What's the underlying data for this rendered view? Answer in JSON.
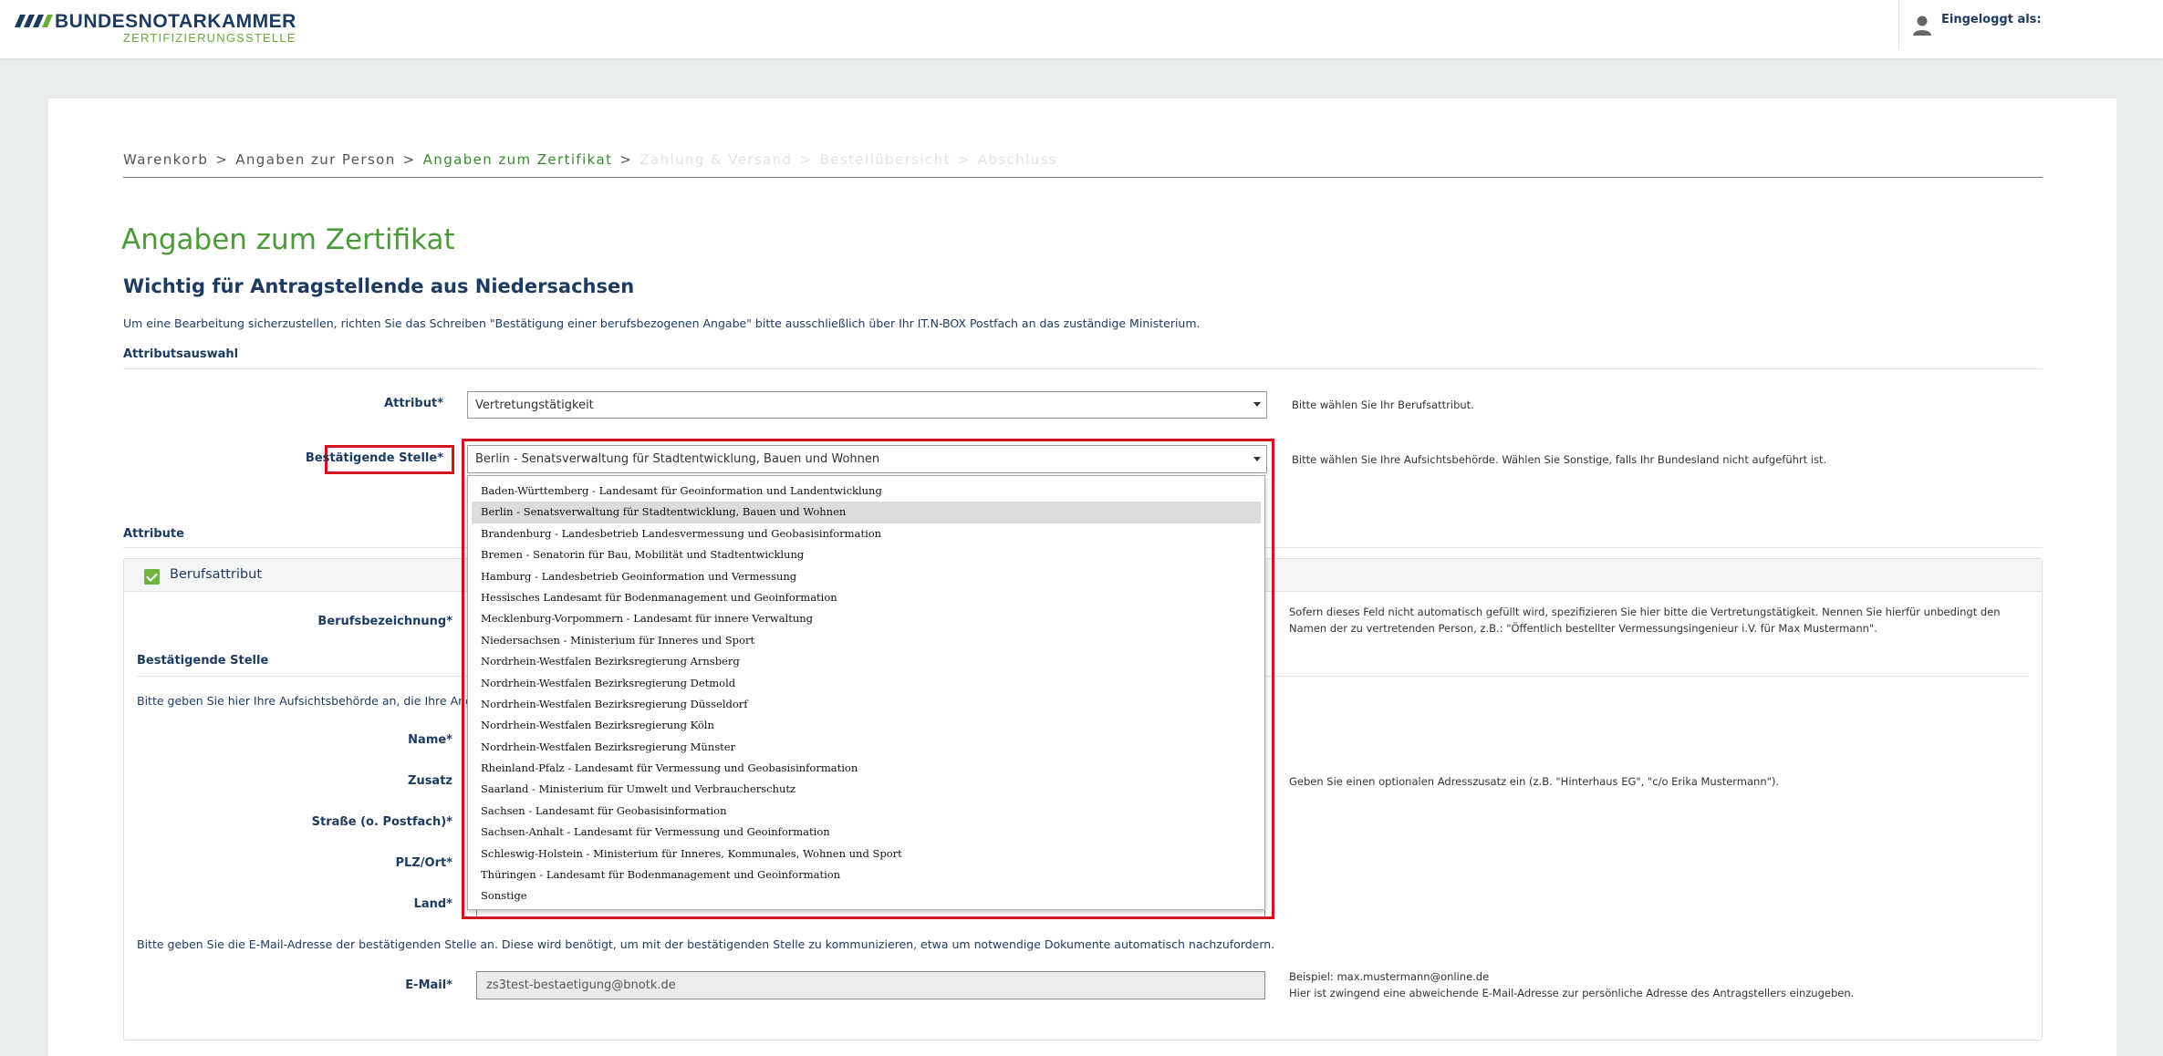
{
  "header": {
    "brand": "BUNDESNOTARKAMMER",
    "sub": "ZERTIFIZIERUNGSSTELLE",
    "user_label": "Eingeloggt als:"
  },
  "breadcrumb": {
    "steps": [
      "Warenkorb",
      "Angaben zur Person",
      "Angaben zum Zertifikat",
      "Zahlung & Versand",
      "Bestellübersicht",
      "Abschluss"
    ],
    "separator": ">"
  },
  "page": {
    "title": "Angaben zum Zertifikat",
    "subtitle": "Wichtig für Antragstellende aus Niedersachsen",
    "info": "Um eine Bearbeitung sicherzustellen, richten Sie das Schreiben \"Bestätigung einer berufsbezogenen Angabe\" bitte ausschließlich über Ihr IT.N-BOX Postfach an das zuständige Ministerium."
  },
  "attributsauswahl": {
    "heading": "Attributsauswahl",
    "attribut_label": "Attribut*",
    "attribut_value": "Vertretungstätigkeit",
    "attribut_hint": "Bitte wählen Sie Ihr Berufsattribut.",
    "stelle_label": "Bestätigende Stelle*",
    "stelle_value": "Berlin - Senatsverwaltung für Stadtentwicklung, Bauen und Wohnen",
    "stelle_hint": "Bitte wählen Sie Ihre Aufsichtsbehörde. Wählen Sie Sonstige, falls Ihr Bundesland nicht aufgeführt ist."
  },
  "attribute": {
    "heading": "Attribute",
    "panel_title": "Berufsattribut",
    "berufsbezeichnung_label": "Berufsbezeichnung*",
    "berufsbezeichnung_hint_1": "Sofern dieses Feld nicht automatisch gefüllt wird, spezifizieren Sie hier bitte die Vertretungstätigkeit. Nennen Sie hierfür unbedingt den",
    "berufsbezeichnung_hint_2": "Namen der zu vertretenden Person, z.B.: \"Öffentlich bestellter Vermessungsingenieur i.V. für Max Mustermann\"."
  },
  "stelle_section": {
    "heading": "Bestätigende Stelle",
    "intro": "Bitte geben Sie hier Ihre Aufsichtsbehörde an, die Ihre Angabe",
    "name_label": "Name*",
    "zusatz_label": "Zusatz",
    "zusatz_hint": "Geben Sie einen optionalen Adresszusatz ein (z.B. \"Hinterhaus EG\", \"c/o Erika Mustermann\").",
    "strasse_label": "Straße (o. Postfach)*",
    "plz_label": "PLZ/Ort*",
    "land_label": "Land*",
    "email_intro": "Bitte geben Sie die E-Mail-Adresse der bestätigenden Stelle an. Diese wird benötigt, um mit der bestätigenden Stelle zu kommunizieren, etwa um notwendige Dokumente automatisch nachzufordern.",
    "email_label": "E-Mail*",
    "email_value": "zs3test-bestaetigung@bnotk.de",
    "email_hint_1": "Beispiel: max.mustermann@online.de",
    "email_hint_2": "Hier ist zwingend eine abweichende E-Mail-Adresse zur persönliche Adresse des Antragstellers einzugeben."
  },
  "dropdown": {
    "options": [
      "Baden-Württemberg - Landesamt für Geoinformation und Landentwicklung",
      "Berlin - Senatsverwaltung für Stadtentwicklung, Bauen und Wohnen",
      "Brandenburg - Landesbetrieb Landesvermessung und Geobasisinformation",
      "Bremen - Senatorin für Bau, Mobilität und Stadtentwicklung",
      "Hamburg - Landesbetrieb Geoinformation und Vermessung",
      "Hessisches Landesamt für Bodenmanagement und Geoinformation",
      "Mecklenburg-Vorpommern - Landesamt für innere Verwaltung",
      "Niedersachsen - Ministerium für Inneres und Sport",
      "Nordrhein-Westfalen Bezirksregierung Arnsberg",
      "Nordrhein-Westfalen Bezirksregierung Detmold",
      "Nordrhein-Westfalen Bezirksregierung Düsseldorf",
      "Nordrhein-Westfalen Bezirksregierung Köln",
      "Nordrhein-Westfalen Bezirksregierung Münster",
      "Rheinland-Pfalz - Landesamt für Vermessung und Geobasisinformation",
      "Saarland - Ministerium für Umwelt und Verbraucherschutz",
      "Sachsen - Landesamt für Geobasisinformation",
      "Sachsen-Anhalt - Landesamt für Vermessung und Geoinformation",
      "Schleswig-Holstein - Ministerium für Inneres, Kommunales, Wohnen und Sport",
      "Thüringen - Landesamt für Bodenmanagement und Geoinformation",
      "Sonstige"
    ],
    "selected_index": 1
  },
  "colors": {
    "navy": "#1d3a5f",
    "green": "#4d9a3a",
    "highlight_red": "#d4141b"
  }
}
